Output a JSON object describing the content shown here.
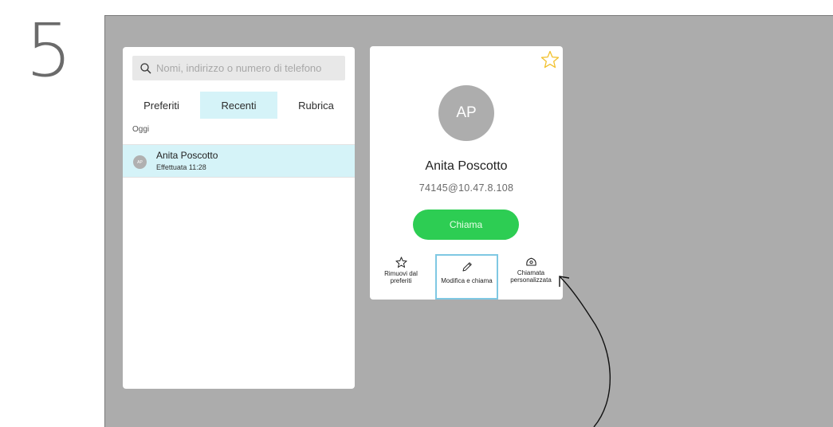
{
  "step": "5",
  "search": {
    "placeholder": "Nomi, indirizzo o numero di telefono"
  },
  "tabs": [
    {
      "label": "Preferiti",
      "active": false
    },
    {
      "label": "Recenti",
      "active": true
    },
    {
      "label": "Rubrica",
      "active": false
    }
  ],
  "section": "Oggi",
  "recent": [
    {
      "initials": "AP",
      "name": "Anita Poscotto",
      "detail": "Effettuata 11:28"
    }
  ],
  "contact": {
    "initials": "AP",
    "name": "Anita Poscotto",
    "address": "74145@10.47.8.108",
    "call_label": "Chiama",
    "favorite_icon": "star-icon"
  },
  "actions": {
    "remove_favorite": {
      "line1": "Rimuovi dal",
      "line2": "preferiti",
      "icon": "star-outline-icon"
    },
    "edit_call": {
      "label": "Modifica e chiama",
      "icon": "pencil-icon"
    },
    "custom_call": {
      "line1": "Chiamata",
      "line2": "personalizzata",
      "icon": "dialpad-icon"
    }
  },
  "colors": {
    "stage": "#acacac",
    "active_tab": "#d5f3f8",
    "call_green": "#2dcd53",
    "favorite_star": "#f2c12e",
    "focus_outline": "#7fc8e3"
  }
}
